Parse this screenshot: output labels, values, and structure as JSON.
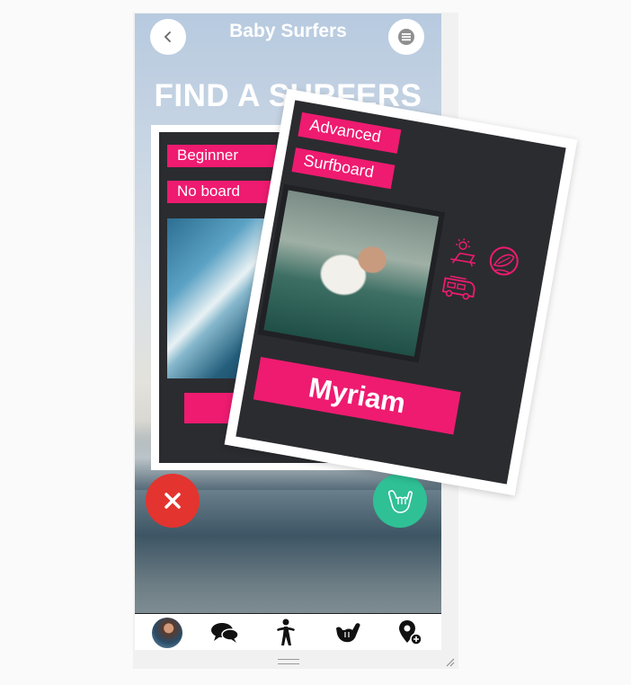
{
  "app": {
    "title": "Baby Surfers"
  },
  "page": {
    "headline": "FIND A SURFERS"
  },
  "back_card": {
    "level_tag": "Beginner",
    "board_tag": "No board"
  },
  "front_card": {
    "level_tag": "Advanced",
    "board_tag": "Surfboard",
    "name": "Myriam",
    "icons": [
      "sun-lounger-icon",
      "surfboard-pin-icon",
      "van-icon"
    ]
  },
  "actions": {
    "reject_icon": "close-icon",
    "like_icon": "shaka-hand-icon"
  },
  "bottom_nav": {
    "items": [
      "profile-avatar",
      "chat-icon",
      "surfer-icon",
      "shaka-hand-icon",
      "add-location-icon"
    ]
  },
  "colors": {
    "accent": "#ee1b70",
    "card": "#2b2c30",
    "reject": "#e3342f",
    "like": "#2fc095"
  }
}
